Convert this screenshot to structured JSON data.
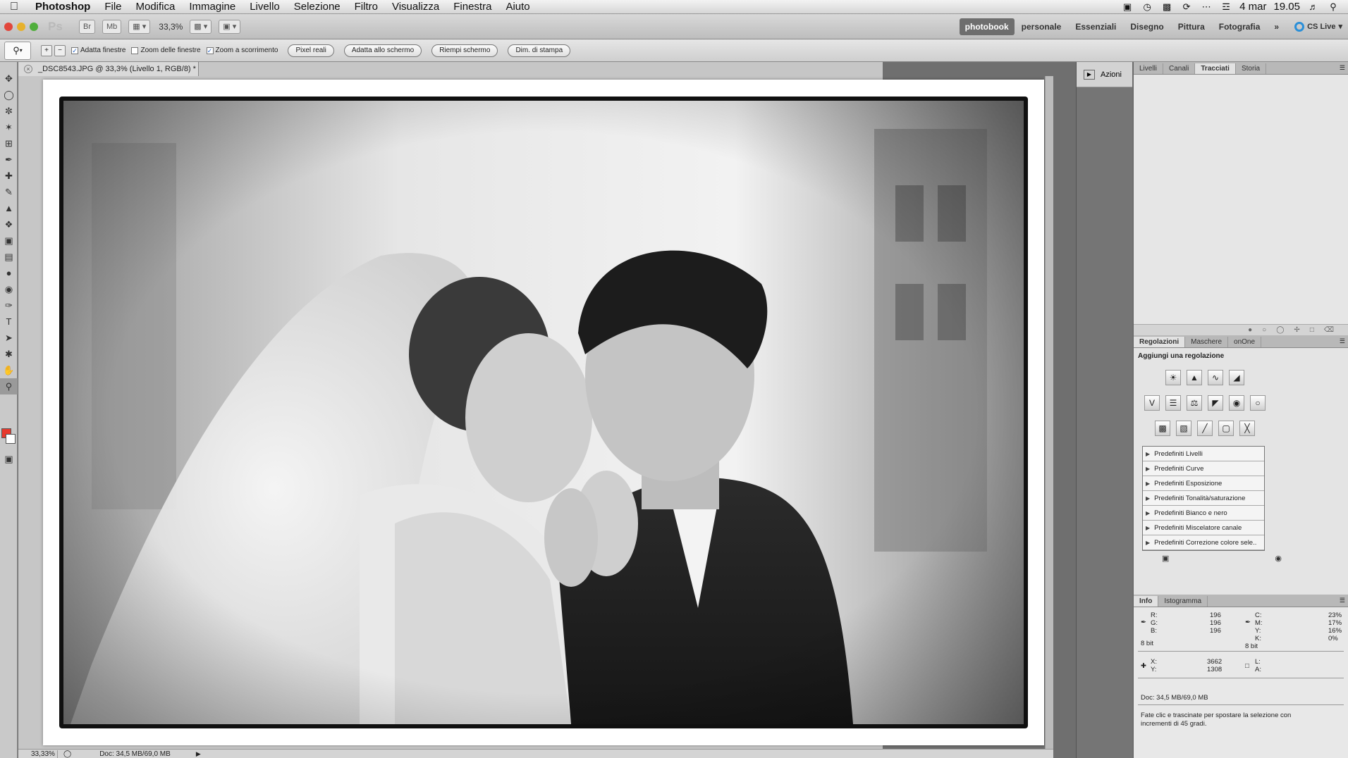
{
  "menubar": {
    "app": "Photoshop",
    "items": [
      "File",
      "Modifica",
      "Immagine",
      "Livello",
      "Selezione",
      "Filtro",
      "Visualizza",
      "Finestra",
      "Aiuto"
    ],
    "date": "4 mar",
    "time": "19.05"
  },
  "appbar": {
    "logo": "Ps",
    "bridge": "Br",
    "minibridge": "Mb",
    "zoom": "33,3%",
    "workspaces": [
      "photobook",
      "personale",
      "Essenziali",
      "Disegno",
      "Pittura",
      "Fotografia"
    ],
    "more": "»",
    "cs_live": "CS Live"
  },
  "options": {
    "adatta_finestre": "Adatta finestre",
    "zoom_finestre": "Zoom delle finestre",
    "zoom_scorrimento": "Zoom a scorrimento",
    "pixel_reali": "Pixel reali",
    "adatta_schermo": "Adatta allo schermo",
    "riempi_schermo": "Riempi schermo",
    "dim_stampa": "Dim. di stampa"
  },
  "document": {
    "tab_title": "_DSC8543.JPG @ 33,3% (Livello 1, RGB/8) *"
  },
  "status": {
    "zoom": "33,33%",
    "doc": "Doc: 34,5 MB/69,0 MB"
  },
  "dock": {
    "actions": "Azioni"
  },
  "panels": {
    "top_tabs": [
      "Livelli",
      "Canali",
      "Tracciati",
      "Storia"
    ],
    "adj_tabs": [
      "Regolazioni",
      "Maschere",
      "onOne"
    ],
    "adj_title": "Aggiungi una regolazione",
    "presets": [
      "Predefiniti Livelli",
      "Predefiniti Curve",
      "Predefiniti Esposizione",
      "Predefiniti Tonalità/saturazione",
      "Predefiniti Bianco e nero",
      "Predefiniti Miscelatore canale",
      "Predefiniti Correzione colore sele.."
    ],
    "info_tabs": [
      "Info",
      "Istogramma"
    ],
    "info": {
      "r_label": "R:",
      "g_label": "G:",
      "b_label": "B:",
      "r": "196",
      "g": "196",
      "b": "196",
      "c_label": "C:",
      "m_label": "M:",
      "y_label": "Y:",
      "k_label": "K:",
      "c": "23%",
      "m": "17%",
      "y": "16%",
      "k": "0%",
      "bit1": "8 bit",
      "bit2": "8 bit",
      "x_label": "X:",
      "y2_label": "Y:",
      "x": "3662",
      "y2": "1308",
      "l_label": "L:",
      "a_label": "A:",
      "doc": "Doc: 34,5 MB/69,0 MB",
      "hint": "Fate clic e trascinate per spostare la selezione con incrementi di 45 gradi."
    }
  }
}
